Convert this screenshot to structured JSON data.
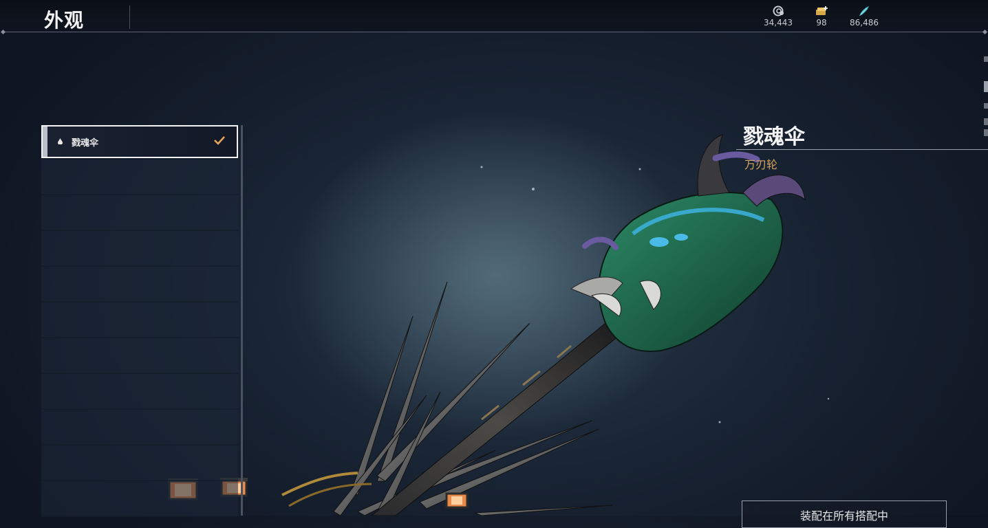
{
  "header": {
    "title": "外观"
  },
  "currencies": [
    {
      "icon": "swirl-coin-icon",
      "amount": "34,443"
    },
    {
      "icon": "gold-ticket-icon",
      "amount": "98"
    },
    {
      "icon": "cyan-feather-icon",
      "amount": "86,486"
    }
  ],
  "skin_list": {
    "items": [
      {
        "label": "戮魂伞",
        "selected": true,
        "equipped": true
      }
    ]
  },
  "detail": {
    "name": "戮魂伞",
    "type": "万刃轮"
  },
  "equip_button": {
    "label": "装配在所有搭配中"
  },
  "colors": {
    "accent_gold": "#d6a55c",
    "check_orange": "#e8a65a",
    "weapon_jade": "#1f6b4f"
  }
}
